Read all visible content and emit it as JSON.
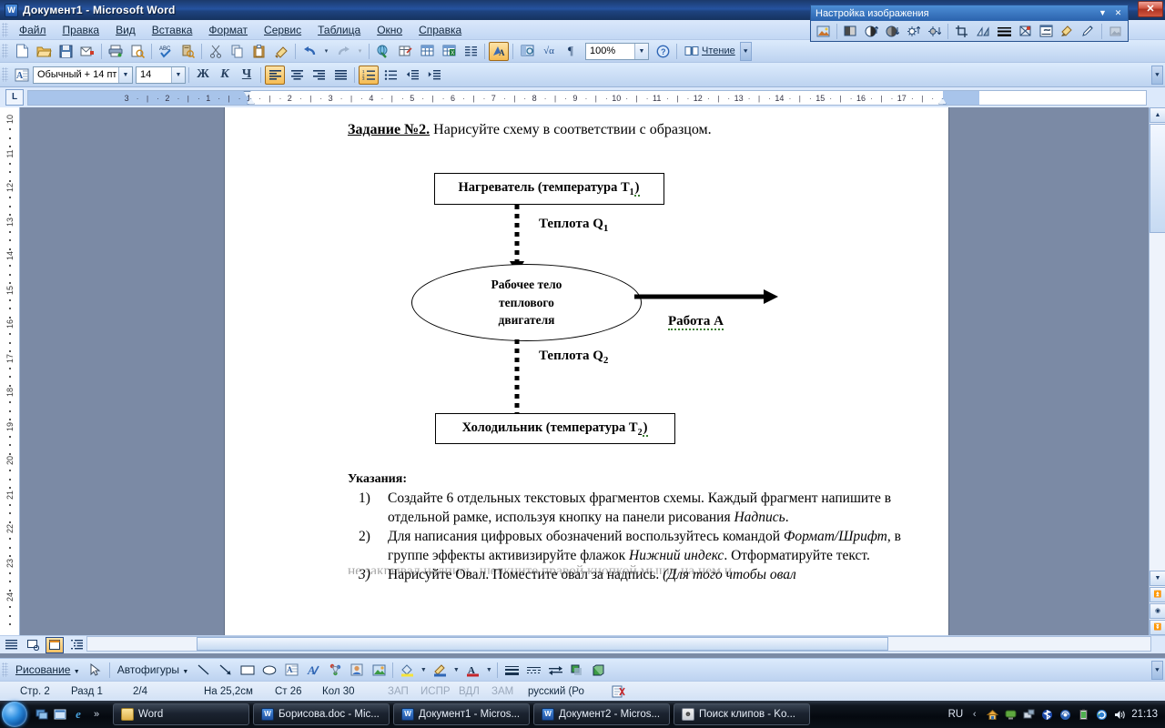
{
  "window": {
    "title": "Документ1 - Microsoft Word",
    "icon": "word-icon",
    "close_label": "✕"
  },
  "menu": {
    "items": [
      {
        "label": "Файл",
        "accel": "Ф"
      },
      {
        "label": "Правка",
        "accel": "П"
      },
      {
        "label": "Вид",
        "accel": "д"
      },
      {
        "label": "Вставка",
        "accel": "а"
      },
      {
        "label": "Формат",
        "accel": "м"
      },
      {
        "label": "Сервис",
        "accel": "е"
      },
      {
        "label": "Таблица",
        "accel": "Т"
      },
      {
        "label": "Окно",
        "accel": "О"
      },
      {
        "label": "Справка",
        "accel": "С"
      }
    ]
  },
  "standard_toolbar": {
    "buttons": [
      {
        "name": "new-document-icon",
        "glyph": "🗋"
      },
      {
        "name": "open-folder-icon",
        "glyph": "📂"
      },
      {
        "name": "save-icon",
        "glyph": "💾"
      },
      {
        "name": "email-icon",
        "glyph": "✉"
      },
      {
        "name": "print-icon",
        "glyph": "🖨"
      },
      {
        "name": "print-preview-icon",
        "glyph": "🔍"
      },
      {
        "name": "spellcheck-icon",
        "glyph": "ABC"
      },
      {
        "name": "research-icon",
        "glyph": "📑"
      },
      {
        "name": "cut-icon",
        "glyph": "✂"
      },
      {
        "name": "copy-icon",
        "glyph": "⧉"
      },
      {
        "name": "paste-icon",
        "glyph": "📋"
      },
      {
        "name": "format-painter-icon",
        "glyph": "🖌"
      },
      {
        "name": "undo-icon",
        "glyph": "↶"
      },
      {
        "name": "undo-dropdown-icon",
        "glyph": "▾"
      },
      {
        "name": "redo-icon",
        "glyph": "↷"
      },
      {
        "name": "redo-dropdown-icon",
        "glyph": "▾"
      },
      {
        "name": "hyperlink-icon",
        "glyph": "🌐"
      },
      {
        "name": "tables-borders-icon",
        "glyph": "▦"
      },
      {
        "name": "insert-table-icon",
        "glyph": "▤"
      },
      {
        "name": "insert-excel-sheet-icon",
        "glyph": "▩"
      },
      {
        "name": "columns-icon",
        "glyph": "≣"
      },
      {
        "name": "drawing-icon",
        "glyph": "A"
      },
      {
        "name": "document-map-icon",
        "glyph": "🗺"
      },
      {
        "name": "formula-icon",
        "glyph": "√α"
      },
      {
        "name": "show-formatting-icon",
        "glyph": "¶"
      }
    ],
    "zoom_value": "100%",
    "help_icon": "help-icon",
    "read_label": "Чтение",
    "read_accel": "Ч",
    "overflow_icon": "toolbar-overflow-icon"
  },
  "formatting_toolbar": {
    "style_value": "Обычный + 14 пт",
    "font_size_value": "14",
    "bold_label": "Ж",
    "italic_label": "К",
    "underline_label": "Ч",
    "align_left_icon": "align-left-icon",
    "align_center_icon": "align-center-icon",
    "align_right_icon": "align-right-icon",
    "align_justify_icon": "align-justify-icon",
    "numbered_list_icon": "numbered-list-icon",
    "bulleted_list_icon": "bulleted-list-icon",
    "decrease_indent_icon": "decrease-indent-icon",
    "increase_indent_icon": "increase-indent-icon"
  },
  "picture_toolbar": {
    "title": "Настройка изображения",
    "minimize_glyph": "▼",
    "close_glyph": "✕",
    "buttons": [
      {
        "name": "insert-picture-icon",
        "glyph": "🖼"
      },
      {
        "name": "color-mode-icon",
        "glyph": "◧"
      },
      {
        "name": "more-contrast-icon",
        "glyph": "◑"
      },
      {
        "name": "less-contrast-icon",
        "glyph": "◕"
      },
      {
        "name": "more-brightness-icon",
        "glyph": "☀"
      },
      {
        "name": "less-brightness-icon",
        "glyph": "☼"
      },
      {
        "name": "crop-icon",
        "glyph": "⌗"
      },
      {
        "name": "rotate-left-icon",
        "glyph": "⟲"
      },
      {
        "name": "line-style-icon",
        "glyph": "≡"
      },
      {
        "name": "compress-pictures-icon",
        "glyph": "⊠"
      },
      {
        "name": "text-wrapping-icon",
        "glyph": "▤"
      },
      {
        "name": "format-picture-icon",
        "glyph": "🖌"
      },
      {
        "name": "set-transparent-color-icon",
        "glyph": "✎"
      },
      {
        "name": "reset-picture-icon",
        "glyph": "↺"
      }
    ]
  },
  "ruler": {
    "tab_selector_icon": "tab-left-icon",
    "left_numbers": [
      "3",
      "2",
      "1"
    ],
    "numbers": [
      "1",
      "2",
      "3",
      "4",
      "5",
      "6",
      "7",
      "8",
      "9",
      "10",
      "11",
      "12",
      "13",
      "14",
      "15",
      "16",
      "17"
    ],
    "vertical_numbers": [
      "10",
      "11",
      "12",
      "13",
      "14",
      "15",
      "16",
      "17",
      "18",
      "19",
      "20",
      "21",
      "22",
      "23",
      "24"
    ]
  },
  "document": {
    "heading_bold": "Задание №2.",
    "heading_rest": " Нарисуйте схему в соответствии с образцом.",
    "diagram": {
      "heater_text": "Нагреватель (температура T",
      "heater_sub": "1",
      "heater_tail": ")",
      "heat_in_label": "Теплота Q",
      "heat_in_sub": "1",
      "body_line1": "Рабочее тело",
      "body_line2": "теплового",
      "body_line3": "двигателя",
      "work_label": "Работа A",
      "heat_out_label": "Теплота Q",
      "heat_out_sub": "2",
      "cooler_text": "Холодильник (температура T",
      "cooler_sub": "2",
      "cooler_tail": ")"
    },
    "instructions_caption": "Указания:",
    "instructions": [
      {
        "num": "1)",
        "parts": [
          {
            "t": "Создайте 6 отдельных текстовых фрагментов схемы. Каждый фрагмент напишите в отдельной рамке, используя кнопку на панели рисования ",
            "i": false
          },
          {
            "t": "Надпись",
            "i": true
          },
          {
            "t": ".",
            "i": false
          }
        ]
      },
      {
        "num": "2)",
        "parts": [
          {
            "t": "Для написания цифровых обозначений воспользуйтесь командой ",
            "i": false
          },
          {
            "t": "Формат/Шрифт",
            "i": true
          },
          {
            "t": ", в группе эффекты активизируйте флажок ",
            "i": false
          },
          {
            "t": "Нижний индекс",
            "i": true
          },
          {
            "t": ". Отформатируйте текст.",
            "i": false
          }
        ]
      },
      {
        "num": "3)",
        "num_italic": true,
        "parts": [
          {
            "t": "Нарисуйте Овал. Поместите овал за надпись. ",
            "i": false
          },
          {
            "t": "(Для того чтобы овал",
            "i": true
          }
        ]
      }
    ],
    "clipped_line": "не закрывал надпись, щелкните правой кнопкой мыши на нем и"
  },
  "view_bar": {
    "buttons": [
      {
        "name": "normal-view-icon",
        "glyph": "≡"
      },
      {
        "name": "web-layout-view-icon",
        "glyph": "🖳"
      },
      {
        "name": "print-layout-view-icon",
        "glyph": "▤"
      },
      {
        "name": "outline-view-icon",
        "glyph": "⋮≡"
      },
      {
        "name": "reading-layout-view-icon",
        "glyph": "📖"
      }
    ],
    "selected_index": 2
  },
  "drawing_toolbar": {
    "label": "Рисование",
    "label_accel": "Р",
    "select_icon": "select-objects-icon",
    "autoshapes_label": "Автофигуры",
    "autoshapes_accel": "г",
    "buttons": [
      {
        "name": "line-icon",
        "glyph": "╲"
      },
      {
        "name": "arrow-icon",
        "glyph": "↘"
      },
      {
        "name": "rectangle-icon",
        "glyph": "▭"
      },
      {
        "name": "oval-icon",
        "glyph": "◯"
      },
      {
        "name": "text-box-icon",
        "glyph": "▤"
      },
      {
        "name": "wordart-icon",
        "glyph": "A"
      },
      {
        "name": "diagram-icon",
        "glyph": "⁂"
      },
      {
        "name": "clip-art-icon",
        "glyph": "☻"
      },
      {
        "name": "insert-picture-icon",
        "glyph": "🖼"
      },
      {
        "name": "fill-color-icon",
        "glyph": "🪣"
      },
      {
        "name": "line-color-icon",
        "glyph": "🖊"
      },
      {
        "name": "font-color-icon",
        "glyph": "A"
      },
      {
        "name": "line-style-icon",
        "glyph": "≡"
      },
      {
        "name": "dash-style-icon",
        "glyph": "┄"
      },
      {
        "name": "arrow-style-icon",
        "glyph": "⇄"
      },
      {
        "name": "shadow-style-icon",
        "glyph": "▉"
      },
      {
        "name": "3d-style-icon",
        "glyph": "▮"
      }
    ]
  },
  "status_bar": {
    "page": "Стр.  2",
    "section": "Разд 1",
    "pages": "2/4",
    "at": "На 25,2см",
    "line": "Ст 26",
    "col": "Кол 30",
    "rec": "ЗАП",
    "trk": "ИСПР",
    "ext": "ВДЛ",
    "ovr": "ЗАМ",
    "language": "русский (Ро",
    "spell_icon": "spellcheck-status-icon"
  },
  "taskbar": {
    "start_icon": "windows-start-orb",
    "quick_launch": [
      {
        "name": "show-desktop-icon",
        "glyph": "🗗"
      },
      {
        "name": "switch-window-icon",
        "glyph": "🗖"
      },
      {
        "name": "internet-explorer-icon",
        "glyph": "e"
      }
    ],
    "quick_launch_more": "»",
    "tasks": [
      {
        "label": "Word",
        "icon": "folder-icon"
      },
      {
        "label": "Борисова.doc - Mic...",
        "icon": "word-icon"
      },
      {
        "label": "Документ1 - Micros...",
        "icon": "word-icon"
      },
      {
        "label": "Документ2 - Micros...",
        "icon": "word-icon"
      },
      {
        "label": "Поиск клипов - Ko...",
        "icon": "clip-organizer-icon"
      }
    ],
    "language": "RU",
    "tray_icons": [
      {
        "name": "show-hidden-icons-icon",
        "glyph": "‹"
      },
      {
        "name": "network-home-icon",
        "glyph": "🏠"
      },
      {
        "name": "monitor-icon",
        "glyph": "🖥"
      },
      {
        "name": "network-icon",
        "glyph": "🖧"
      },
      {
        "name": "bluetooth-icon",
        "glyph": "✦"
      },
      {
        "name": "wireless-icon",
        "glyph": "◉"
      },
      {
        "name": "battery-icon",
        "glyph": "🔋"
      },
      {
        "name": "sync-icon",
        "glyph": "🔄"
      },
      {
        "name": "volume-icon",
        "glyph": "🔊"
      }
    ],
    "clock": "21:13"
  }
}
